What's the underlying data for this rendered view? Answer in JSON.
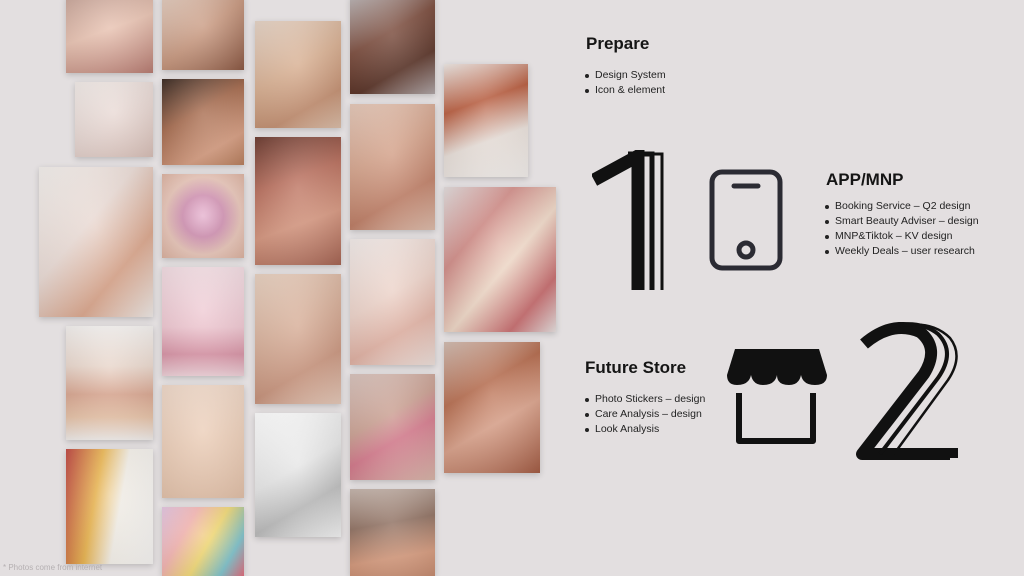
{
  "footnote": "* Photos come from internet",
  "sections": {
    "prepare": {
      "title": "Prepare",
      "items": [
        "Design System",
        "Icon & element"
      ]
    },
    "app": {
      "number": "1",
      "title": "APP/MNP",
      "icon": "smartphone-icon",
      "items": [
        "Booking Service – Q2 design",
        "Smart Beauty Adviser –  design",
        "MNP&Tiktok – KV design",
        "Weekly Deals – user research"
      ]
    },
    "store": {
      "number": "2.",
      "title": "Future Store",
      "icon": "storefront-icon",
      "items": [
        "Photo Stickers – design",
        "Care Analysis – design",
        "Look Analysis"
      ]
    }
  },
  "colors": {
    "background": "#e3dfe0",
    "text": "#151515",
    "icon_stroke": "#2b2b33"
  }
}
